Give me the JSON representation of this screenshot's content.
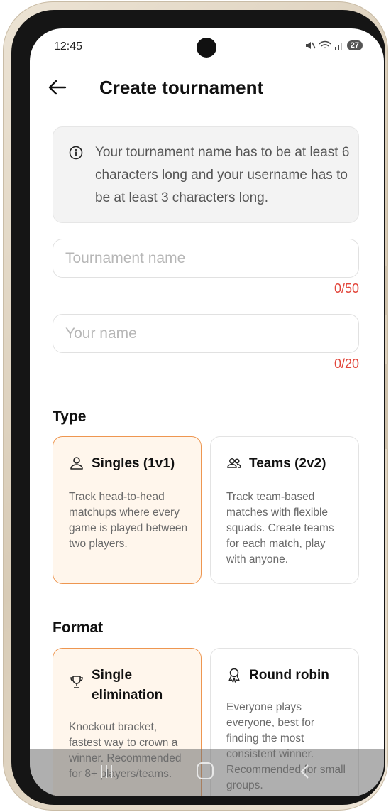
{
  "status_bar": {
    "time": "12:45",
    "battery": "27"
  },
  "header": {
    "title": "Create tournament"
  },
  "info": {
    "text": "Your tournament name has to be at least 6 characters long and your username has to be at least 3 characters long."
  },
  "tournament_name": {
    "placeholder": "Tournament name",
    "value": "",
    "counter": "0/50"
  },
  "your_name": {
    "placeholder": "Your name",
    "value": "",
    "counter": "0/20"
  },
  "type_section": {
    "title": "Type",
    "options": [
      {
        "icon": "person-icon",
        "label": "Singles (1v1)",
        "description": "Track head-to-head matchups where every game is played between two players.",
        "selected": true
      },
      {
        "icon": "group-icon",
        "label": "Teams (2v2)",
        "description": "Track team-based matches with flexible squads. Create teams for each match, play with anyone.",
        "selected": false
      }
    ]
  },
  "format_section": {
    "title": "Format",
    "options": [
      {
        "icon": "trophy-icon",
        "label": "Single elimination",
        "description": "Knockout bracket, fastest way to crown a winner. Recommended for 8+ players/teams.",
        "selected": true
      },
      {
        "icon": "medal-icon",
        "label": "Round robin",
        "description": "Everyone plays everyone, best for finding the most consistent winner. Recommended for small groups.",
        "selected": false
      }
    ]
  },
  "colors": {
    "accent": "#ee9650",
    "selected_bg": "#fff6ec",
    "error": "#e2453a"
  }
}
